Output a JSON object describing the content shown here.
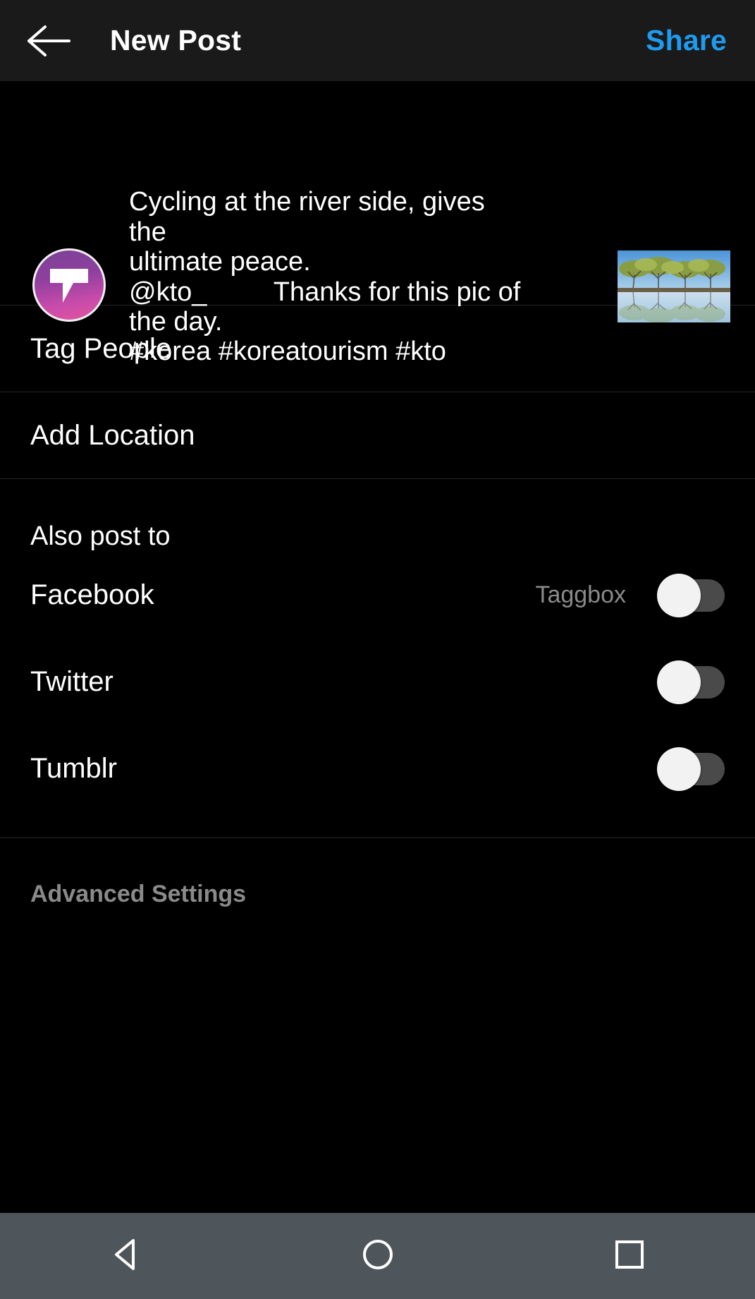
{
  "header": {
    "back_icon": "arrow-left-icon",
    "title": "New Post",
    "share_label": "Share",
    "share_color": "#1e9bf0",
    "background": "#1a1a1a"
  },
  "caption": {
    "avatar_icon": "taggbox-logo-avatar",
    "avatar_gradient_from": "#7b4397",
    "avatar_gradient_to": "#e2559f",
    "text": "Cycling at the river side, gives the\nultimate peace.\n@kto_         Thanks for this pic of\nthe day.",
    "hashtags": "#korea #koreatourism #kto",
    "thumbnail_alt": "trees-reflected-in-water-thumbnail"
  },
  "menu": {
    "items": [
      {
        "label": "Tag People",
        "name": "tag-people"
      },
      {
        "label": "Add Location",
        "name": "add-location"
      }
    ]
  },
  "also_post_to": {
    "heading": "Also post to",
    "services": [
      {
        "label": "Facebook",
        "account": "Taggbox",
        "enabled": false
      },
      {
        "label": "Twitter",
        "account": "",
        "enabled": false
      },
      {
        "label": "Tumblr",
        "account": "",
        "enabled": false
      }
    ],
    "toggle_track_color": "#4a4a4a",
    "toggle_knob_color": "#f2f2f2"
  },
  "advanced_settings": {
    "label": "Advanced Settings",
    "color": "#8a8a8a"
  },
  "navbar": {
    "background": "#4e565c",
    "back_icon": "triangle-back-icon",
    "home_icon": "circle-home-icon",
    "recents_icon": "square-recents-icon"
  }
}
